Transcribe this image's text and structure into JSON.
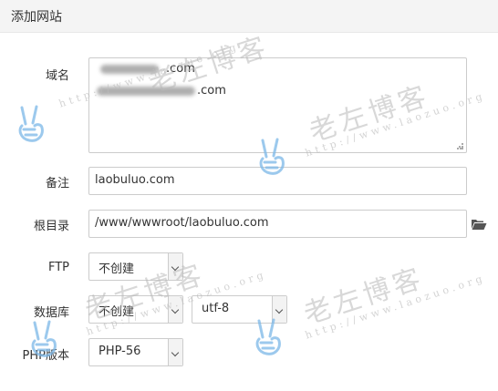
{
  "dialog": {
    "title": "添加网站"
  },
  "form": {
    "domain": {
      "label": "域名",
      "lines": [
        ".com",
        ".com"
      ]
    },
    "remark": {
      "label": "备注",
      "value": "laobuluo.com"
    },
    "root_dir": {
      "label": "根目录",
      "value": "/www/wwwroot/laobuluo.com",
      "browse_icon": "folder-open-icon"
    },
    "ftp": {
      "label": "FTP",
      "selected": "不创建"
    },
    "database": {
      "label": "数据库",
      "selected": "不创建",
      "charset": "utf-8"
    },
    "php": {
      "label": "PHP版本",
      "selected": "PHP-56"
    }
  },
  "watermark": {
    "text": "老左博客",
    "url": "http://www.laozuo.org"
  },
  "colors": {
    "title_bg": "#f4f4f4",
    "border": "#cccccc",
    "watermark_hand": "#8fc3ec"
  }
}
